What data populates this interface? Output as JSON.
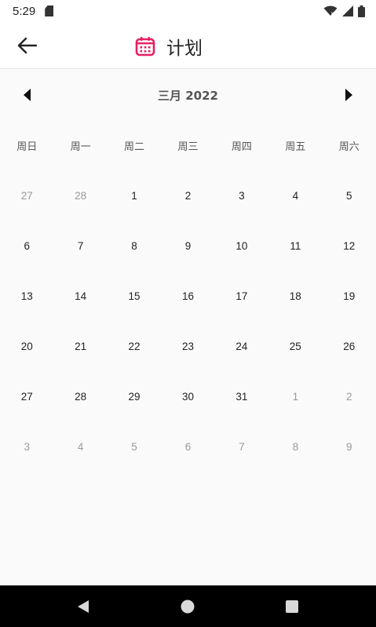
{
  "status_bar": {
    "time": "5:29"
  },
  "app_bar": {
    "title": "计划",
    "accent": "#e91e63"
  },
  "calendar": {
    "month_label": "三月 2022",
    "weekdays": [
      "周日",
      "周一",
      "周二",
      "周三",
      "周四",
      "周五",
      "周六"
    ],
    "weeks": [
      [
        {
          "d": "27",
          "cur": false
        },
        {
          "d": "28",
          "cur": false
        },
        {
          "d": "1",
          "cur": true
        },
        {
          "d": "2",
          "cur": true
        },
        {
          "d": "3",
          "cur": true
        },
        {
          "d": "4",
          "cur": true
        },
        {
          "d": "5",
          "cur": true
        }
      ],
      [
        {
          "d": "6",
          "cur": true
        },
        {
          "d": "7",
          "cur": true
        },
        {
          "d": "8",
          "cur": true
        },
        {
          "d": "9",
          "cur": true
        },
        {
          "d": "10",
          "cur": true
        },
        {
          "d": "11",
          "cur": true
        },
        {
          "d": "12",
          "cur": true
        }
      ],
      [
        {
          "d": "13",
          "cur": true
        },
        {
          "d": "14",
          "cur": true
        },
        {
          "d": "15",
          "cur": true
        },
        {
          "d": "16",
          "cur": true
        },
        {
          "d": "17",
          "cur": true
        },
        {
          "d": "18",
          "cur": true
        },
        {
          "d": "19",
          "cur": true
        }
      ],
      [
        {
          "d": "20",
          "cur": true
        },
        {
          "d": "21",
          "cur": true
        },
        {
          "d": "22",
          "cur": true
        },
        {
          "d": "23",
          "cur": true
        },
        {
          "d": "24",
          "cur": true
        },
        {
          "d": "25",
          "cur": true
        },
        {
          "d": "26",
          "cur": true
        }
      ],
      [
        {
          "d": "27",
          "cur": true
        },
        {
          "d": "28",
          "cur": true
        },
        {
          "d": "29",
          "cur": true
        },
        {
          "d": "30",
          "cur": true
        },
        {
          "d": "31",
          "cur": true
        },
        {
          "d": "1",
          "cur": false
        },
        {
          "d": "2",
          "cur": false
        }
      ],
      [
        {
          "d": "3",
          "cur": false
        },
        {
          "d": "4",
          "cur": false
        },
        {
          "d": "5",
          "cur": false
        },
        {
          "d": "6",
          "cur": false
        },
        {
          "d": "7",
          "cur": false
        },
        {
          "d": "8",
          "cur": false
        },
        {
          "d": "9",
          "cur": false
        }
      ]
    ]
  },
  "icons": {
    "back": "arrow-left-icon",
    "calendar": "calendar-icon",
    "prev": "triangle-left-icon",
    "next": "triangle-right-icon",
    "wifi": "wifi-icon",
    "signal": "signal-icon",
    "battery": "battery-icon",
    "sd": "sd-card-icon",
    "nav_back": "nav-back-icon",
    "nav_home": "nav-home-icon",
    "nav_recents": "nav-recents-icon"
  }
}
